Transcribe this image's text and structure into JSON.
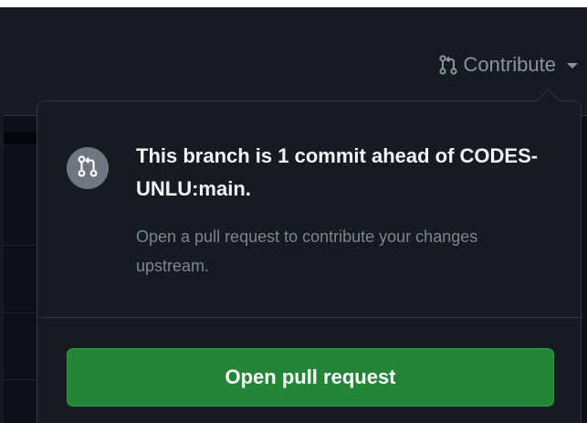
{
  "header": {
    "contribute_label": "Contribute",
    "contribute_icon": "git-pull-request-icon"
  },
  "popover": {
    "title": "This branch is 1 commit ahead of CODES-UNLU:main.",
    "description": "Open a pull request to contribute your changes upstream.",
    "icon": "git-pull-request-icon",
    "button_label": "Open pull request"
  },
  "colors": {
    "background": "#0d1117",
    "panel": "#161b22",
    "border": "#30363d",
    "muted_text": "#8b949e",
    "title_text": "#f0f6fc",
    "icon_circle": "#6e7681",
    "button_green": "#238636"
  }
}
